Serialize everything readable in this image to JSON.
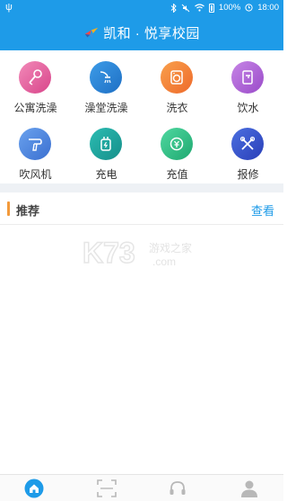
{
  "status_bar": {
    "battery_percent": "100%",
    "time": "18:00",
    "icons": [
      "usb-icon",
      "bluetooth-icon",
      "mute-icon",
      "wifi-icon",
      "battery-icon"
    ]
  },
  "header": {
    "title": "凯和 · 悦享校园",
    "logo": "bird-logo-icon",
    "background": "#1e9be8"
  },
  "services": [
    {
      "label": "公寓洗澡",
      "icon": "shower-head-icon",
      "color": "#e85a9c"
    },
    {
      "label": "澡堂洗澡",
      "icon": "shower-icon",
      "color": "#2f86d8"
    },
    {
      "label": "洗衣",
      "icon": "washing-machine-icon",
      "color": "#f5823a"
    },
    {
      "label": "饮水",
      "icon": "water-dispenser-icon",
      "color": "#b063d6"
    },
    {
      "label": "吹风机",
      "icon": "hair-dryer-icon",
      "color": "#4a88e0"
    },
    {
      "label": "充电",
      "icon": "charging-icon",
      "color": "#1ea8a0"
    },
    {
      "label": "充值",
      "icon": "recharge-coin-icon",
      "color": "#2cc28a"
    },
    {
      "label": "报修",
      "icon": "repair-tools-icon",
      "color": "#3a5bd6"
    }
  ],
  "recommend": {
    "title": "推荐",
    "view_link": "查看",
    "accent_color": "#f39a3b"
  },
  "watermark": {
    "brand": "K73",
    "site_name": "游戏之家",
    "domain": ".com"
  },
  "tabbar": {
    "tabs": [
      {
        "icon": "home-icon",
        "active": true
      },
      {
        "icon": "scan-icon",
        "active": false
      },
      {
        "icon": "service-headset-icon",
        "active": false
      },
      {
        "icon": "profile-icon",
        "active": false
      }
    ]
  }
}
